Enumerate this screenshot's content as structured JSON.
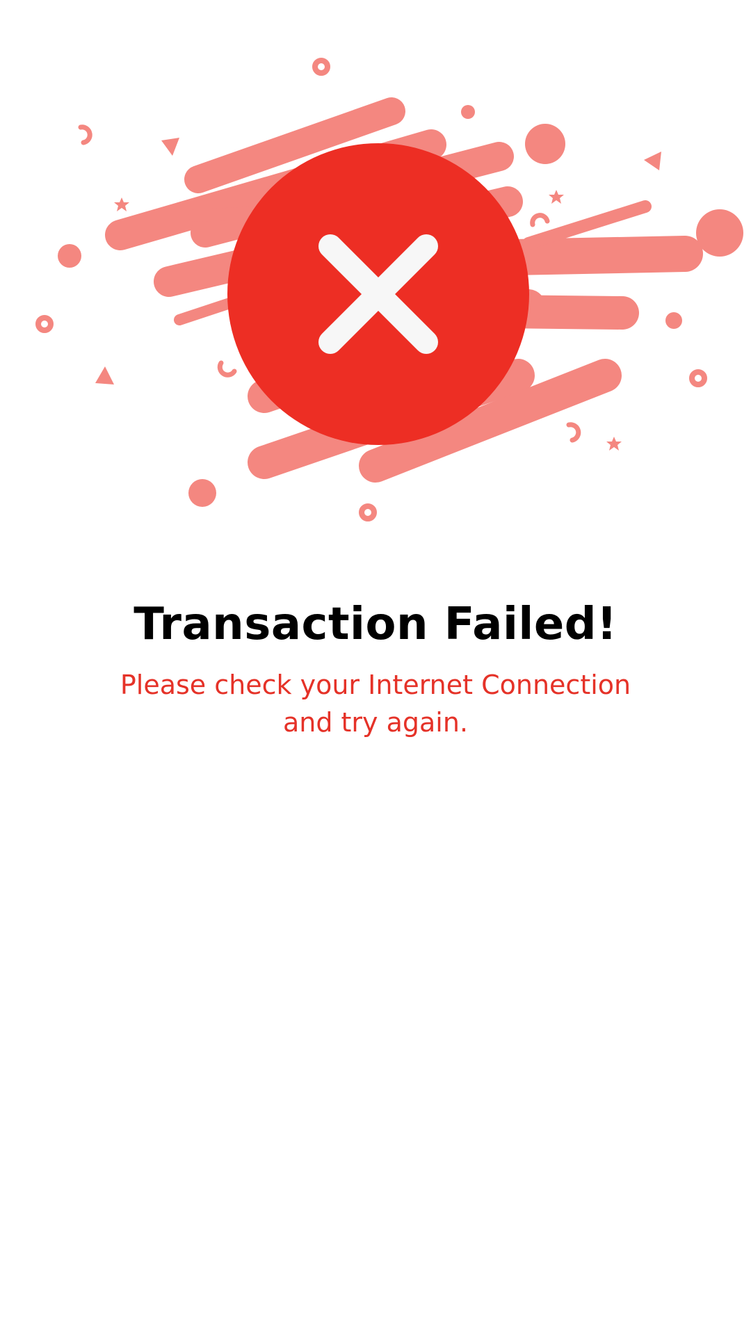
{
  "status": {
    "title": "Transaction Failed!",
    "message": "Please check your Internet Connection and try again."
  },
  "icons": {
    "status_icon": "error-x-circle-icon"
  },
  "colors": {
    "accent_red": "#ED2E24",
    "decoration_pink": "#F48780",
    "icon_glyph": "#F7F7F7",
    "title_text": "#000000",
    "message_text": "#E53228",
    "background": "#FFFFFF"
  }
}
